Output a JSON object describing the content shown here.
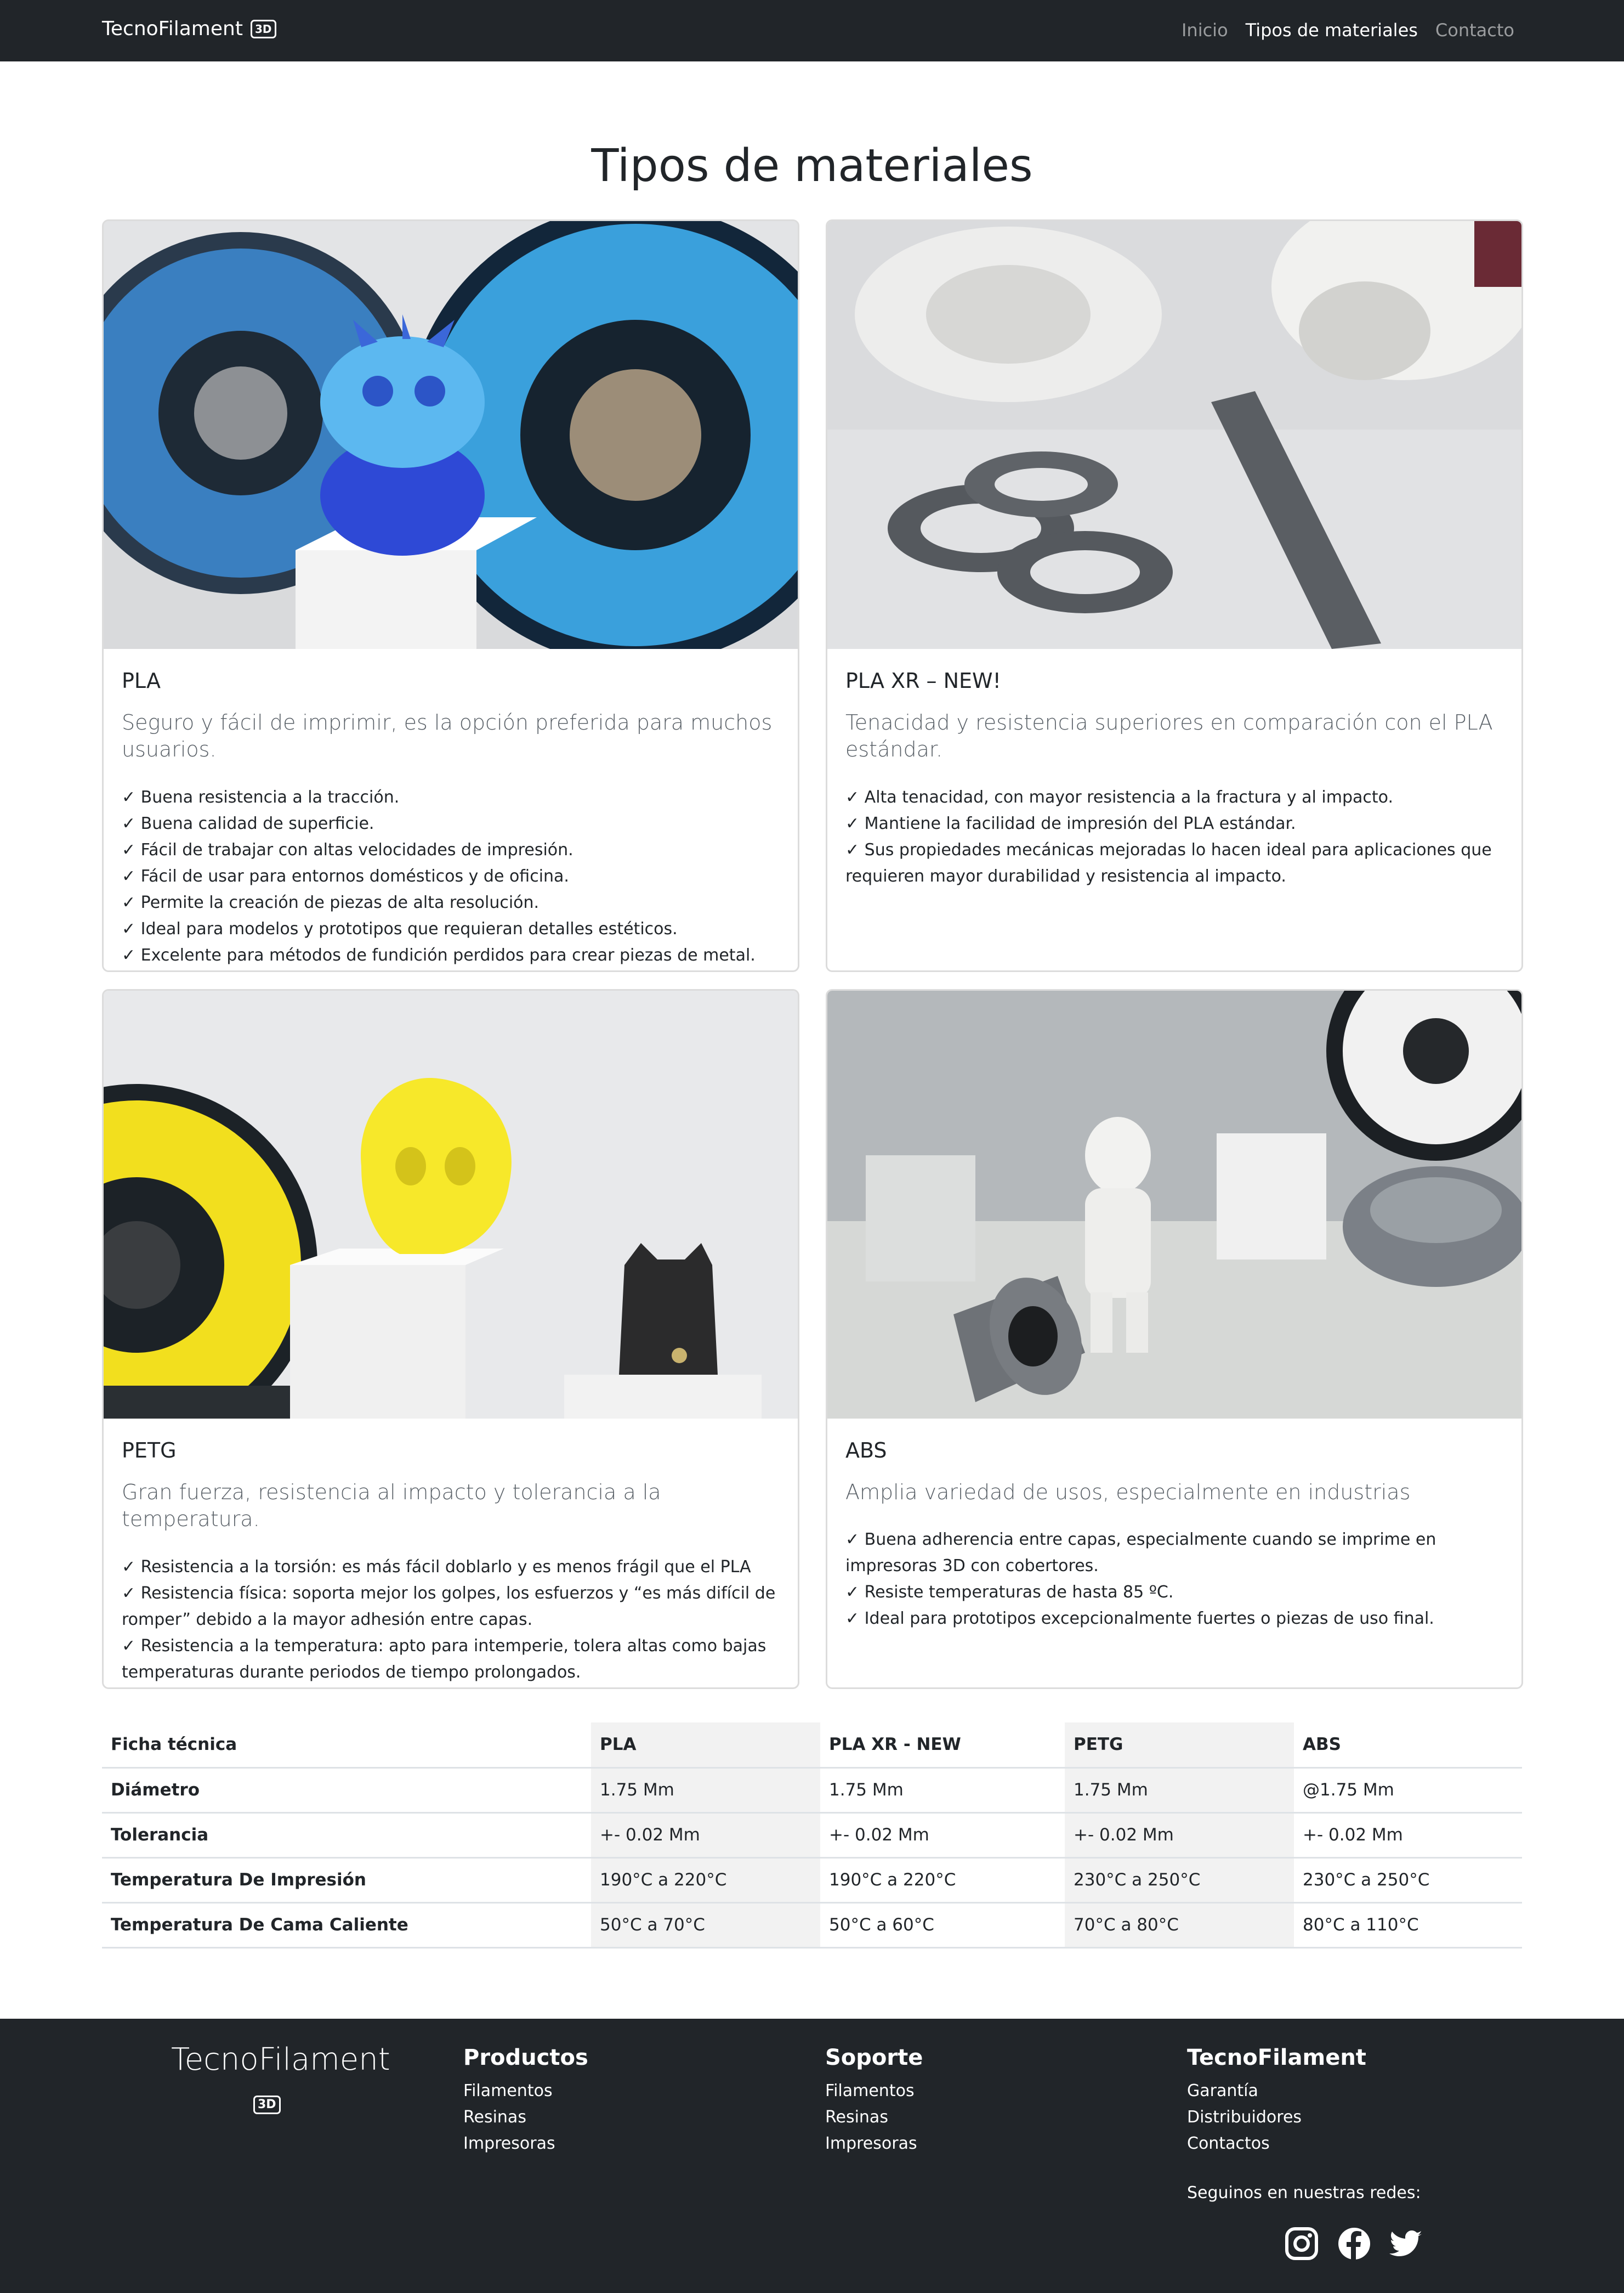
{
  "navbar": {
    "brand": "TecnoFilament",
    "brand_badge": "3D",
    "links": [
      "Inicio",
      "Tipos de materiales",
      "Contacto"
    ],
    "active_index": 1
  },
  "page": {
    "title": "Tipos de materiales"
  },
  "cards": [
    {
      "title": "PLA",
      "lead": "Seguro y fácil de imprimir, es la opción preferida para muchos usuarios.",
      "items": [
        "✓ Buena resistencia a la tracción.",
        "✓ Buena calidad de superficie.",
        "✓ Fácil de trabajar con altas velocidades de impresión.",
        "✓ Fácil de usar para entornos domésticos y de oficina.",
        "✓ Permite la creación de piezas de alta resolución.",
        "✓ Ideal para modelos y prototipos que requieran detalles estéticos.",
        "✓ Excelente para métodos de fundición perdidos para crear piezas de metal."
      ]
    },
    {
      "title": "PLA XR – NEW!",
      "lead": "Tenacidad y resistencia superiores en comparación con el PLA estándar.",
      "items": [
        "✓ Alta tenacidad, con mayor resistencia a la fractura y al impacto.",
        "✓ Mantiene la facilidad de impresión del PLA estándar.",
        "✓ Sus propiedades mecánicas mejoradas lo hacen ideal para aplicaciones que requieren mayor durabilidad y resistencia al impacto."
      ]
    },
    {
      "title": "PETG",
      "lead": "Gran fuerza, resistencia al impacto y tolerancia a la temperatura.",
      "items": [
        "✓ Resistencia a la torsión: es más fácil doblarlo y es menos frágil que el PLA",
        "✓ Resistencia física: soporta mejor los golpes, los esfuerzos y “es más difícil de romper” debido a la mayor adhesión entre capas.",
        "✓ Resistencia a la temperatura: apto para intemperie, tolera altas como bajas temperaturas durante periodos de tiempo prolongados."
      ]
    },
    {
      "title": "ABS",
      "lead": "Amplia variedad de usos, especialmente en industrias",
      "items": [
        "✓ Buena adherencia entre capas, especialmente cuando se imprime en impresoras 3D con cobertores.",
        "✓ Resiste temperaturas de hasta 85 ºC.",
        "✓ Ideal para prototipos excepcionalmente fuertes o piezas de uso final."
      ]
    }
  ],
  "table": {
    "headers": [
      "Ficha técnica",
      "PLA",
      "PLA XR - NEW",
      "PETG",
      "ABS"
    ],
    "rows": [
      [
        "Diámetro",
        "1.75 Mm",
        "1.75 Mm",
        "1.75 Mm",
        "@1.75 Mm"
      ],
      [
        "Tolerancia",
        "+- 0.02 Mm",
        "+- 0.02 Mm",
        "+- 0.02 Mm",
        "+- 0.02 Mm"
      ],
      [
        "Temperatura De Impresión",
        "190°C a 220°C",
        "190°C a 220°C",
        "230°C a 250°C",
        "230°C a 250°C"
      ],
      [
        "Temperatura De Cama Caliente",
        "50°C a 70°C",
        "50°C a 60°C",
        "70°C a 80°C",
        "80°C a 110°C"
      ]
    ]
  },
  "footer": {
    "brand": "TecnoFilament",
    "brand_badge": "3D",
    "columns": [
      {
        "title": "Productos",
        "items": [
          "Filamentos",
          "Resinas",
          "Impresoras"
        ]
      },
      {
        "title": "Soporte",
        "items": [
          "Filamentos",
          "Resinas",
          "Impresoras"
        ]
      },
      {
        "title": "TecnoFilament",
        "items": [
          "Garantía",
          "Distribuidores",
          "Contactos"
        ]
      }
    ],
    "follow_text": "Seguinos en nuestras redes:",
    "social": [
      "instagram-icon",
      "facebook-icon",
      "twitter-icon"
    ]
  },
  "colors": {
    "dark": "#212529",
    "muted_text": "#5a6168",
    "table_shade": "#f2f2f2"
  }
}
